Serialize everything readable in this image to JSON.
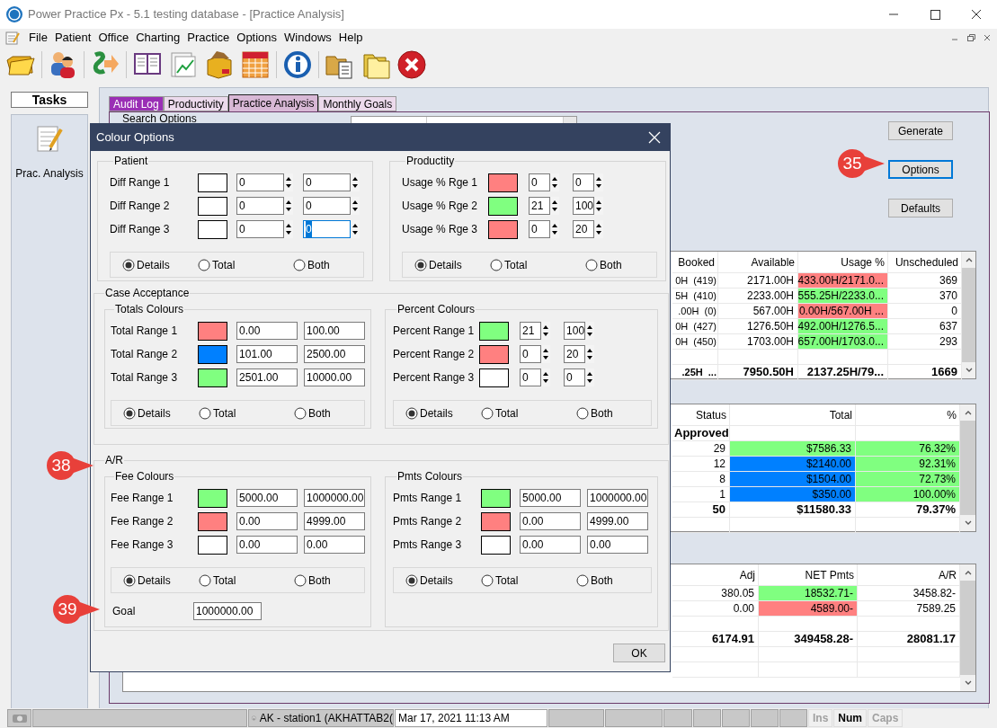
{
  "window": {
    "title": "Power Practice Px - 5.1 testing database - [Practice Analysis]"
  },
  "menu": [
    "File",
    "Patient",
    "Office",
    "Charting",
    "Practice",
    "Options",
    "Windows",
    "Help"
  ],
  "tasks": {
    "title": "Tasks",
    "items": [
      "Prac. Analysis"
    ]
  },
  "tabs": [
    {
      "label": "Audit Log",
      "selected": false,
      "color": "#9a2fb5"
    },
    {
      "label": "Productivity",
      "selected": false,
      "color": "#ecdaec"
    },
    {
      "label": "Practice Analysis",
      "selected": true,
      "color": "#d8b8d6"
    },
    {
      "label": "Monthly Goals",
      "selected": false,
      "color": "#ecdaec"
    }
  ],
  "search_options": {
    "label": "Search Options"
  },
  "buttons": [
    {
      "label": "Generate",
      "focused": false
    },
    {
      "label": "Options",
      "focused": true
    },
    {
      "label": "Defaults",
      "focused": false
    }
  ],
  "tables": [
    {
      "columns": [
        "Booked",
        "Available",
        "Usage %",
        "Unscheduled"
      ],
      "rows": [
        {
          "kind": "data",
          "cells": [
            {
              "text": "0H  (419)"
            },
            {
              "text": "2171.00H"
            },
            {
              "text": "433.00H/2171.0...",
              "color": "#ff8080"
            },
            {
              "text": "369"
            }
          ]
        },
        {
          "kind": "data",
          "cells": [
            {
              "text": "5H  (410)"
            },
            {
              "text": "2233.00H"
            },
            {
              "text": "555.25H/2233.0...",
              "color": "#80ff80"
            },
            {
              "text": "370"
            }
          ]
        },
        {
          "kind": "data",
          "cells": [
            {
              "text": ".00H  (0)"
            },
            {
              "text": "567.00H"
            },
            {
              "text": "0.00H/567.00H ...",
              "color": "#ff8080"
            },
            {
              "text": "0"
            }
          ]
        },
        {
          "kind": "data",
          "cells": [
            {
              "text": "0H  (427)"
            },
            {
              "text": "1276.50H"
            },
            {
              "text": "492.00H/1276.5...",
              "color": "#80ff80"
            },
            {
              "text": "637"
            }
          ]
        },
        {
          "kind": "data",
          "cells": [
            {
              "text": "0H  (450)"
            },
            {
              "text": "1703.00H"
            },
            {
              "text": "657.00H/1703.0...",
              "color": "#80ff80"
            },
            {
              "text": "293"
            }
          ]
        },
        {
          "kind": "blank"
        },
        {
          "kind": "total",
          "cells": [
            {
              "text": ".25H  ..."
            },
            {
              "text": "7950.50H"
            },
            {
              "text": "2137.25H/79..."
            },
            {
              "text": "1669"
            }
          ]
        }
      ]
    },
    {
      "columns": [
        "Status",
        "Total",
        "%"
      ],
      "rows": [
        {
          "kind": "group",
          "cells": [
            {
              "text": "Approved"
            }
          ]
        },
        {
          "kind": "data",
          "cells": [
            {
              "text": "29"
            },
            {
              "text": "$7586.33",
              "color": "#80ff80"
            },
            {
              "text": "76.32%",
              "color": "#80ff80"
            }
          ]
        },
        {
          "kind": "data",
          "cells": [
            {
              "text": "12"
            },
            {
              "text": "$2140.00",
              "color": "#0080ff"
            },
            {
              "text": "92.31%",
              "color": "#80ff80"
            }
          ]
        },
        {
          "kind": "data",
          "cells": [
            {
              "text": "8"
            },
            {
              "text": "$1504.00",
              "color": "#0080ff"
            },
            {
              "text": "72.73%",
              "color": "#80ff80"
            }
          ]
        },
        {
          "kind": "data",
          "cells": [
            {
              "text": "1"
            },
            {
              "text": "$350.00",
              "color": "#0080ff"
            },
            {
              "text": "100.00%",
              "color": "#80ff80"
            }
          ]
        },
        {
          "kind": "total",
          "cells": [
            {
              "text": "50"
            },
            {
              "text": "$11580.33"
            },
            {
              "text": "79.37%"
            }
          ]
        },
        {
          "kind": "blank"
        }
      ]
    },
    {
      "columns": [
        "Adj",
        "NET Pmts",
        "A/R"
      ],
      "rows": [
        {
          "kind": "data",
          "cells": [
            {
              "text": "380.05"
            },
            {
              "text": "18532.71-",
              "color": "#80ff80"
            },
            {
              "text": "3458.82-"
            }
          ]
        },
        {
          "kind": "data",
          "cells": [
            {
              "text": "0.00"
            },
            {
              "text": "4589.00-",
              "color": "#ff8080"
            },
            {
              "text": "7589.25"
            }
          ]
        },
        {
          "kind": "blank"
        },
        {
          "kind": "total",
          "cells": [
            {
              "text": "6174.91"
            },
            {
              "text": "349458.28-"
            },
            {
              "text": "28081.17"
            }
          ]
        },
        {
          "kind": "blank"
        },
        {
          "kind": "blank"
        }
      ]
    }
  ],
  "dialog": {
    "title": "Colour Options",
    "top": [
      {
        "title": "Patient",
        "kind": "wide_spin",
        "ranges": [
          {
            "label": "Diff Range 1",
            "color": "#ffffff",
            "from": "0",
            "to": "0",
            "to_focused": false
          },
          {
            "label": "Diff Range 2",
            "color": "#ffffff",
            "from": "0",
            "to": "0",
            "to_focused": false
          },
          {
            "label": "Diff Range 3",
            "color": "#ffffff",
            "from": "0",
            "to": "0",
            "to_focused": true
          }
        ],
        "radios": [
          {
            "label": "Details",
            "selected": true
          },
          {
            "label": "Total",
            "selected": false
          },
          {
            "label": "Both",
            "selected": false
          }
        ]
      },
      {
        "title": "Productity",
        "kind": "narrow_spin",
        "ranges": [
          {
            "label": "Usage % Rge 1",
            "color": "#ff8080",
            "from": "0",
            "to": "0"
          },
          {
            "label": "Usage % Rge 2",
            "color": "#80ff80",
            "from": "21",
            "to": "100"
          },
          {
            "label": "Usage % Rge 3",
            "color": "#ff8080",
            "from": "0",
            "to": "20"
          }
        ],
        "radios": [
          {
            "label": "Details",
            "selected": true
          },
          {
            "label": "Total",
            "selected": false
          },
          {
            "label": "Both",
            "selected": false
          }
        ]
      }
    ],
    "case_acceptance": {
      "title": "Case Acceptance",
      "groups": [
        {
          "title": "Totals Colours",
          "kind": "text",
          "ranges": [
            {
              "label": "Total Range 1",
              "color": "#ff8080",
              "from": "0.00",
              "to": "100.00"
            },
            {
              "label": "Total Range 2",
              "color": "#0080ff",
              "from": "101.00",
              "to": "2500.00"
            },
            {
              "label": "Total Range 3",
              "color": "#80ff80",
              "from": "2501.00",
              "to": "10000.00"
            }
          ],
          "radios": [
            {
              "label": "Details",
              "selected": true
            },
            {
              "label": "Total",
              "selected": false
            },
            {
              "label": "Both",
              "selected": false
            }
          ]
        },
        {
          "title": "Percent Colours",
          "kind": "narrow_spin",
          "ranges": [
            {
              "label": "Percent Range 1",
              "color": "#80ff80",
              "from": "21",
              "to": "100"
            },
            {
              "label": "Percent Range 2",
              "color": "#ff8080",
              "from": "0",
              "to": "20"
            },
            {
              "label": "Percent Range 3",
              "color": "#ffffff",
              "from": "0",
              "to": "0"
            }
          ],
          "radios": [
            {
              "label": "Details",
              "selected": true
            },
            {
              "label": "Total",
              "selected": false
            },
            {
              "label": "Both",
              "selected": false
            }
          ]
        }
      ]
    },
    "ar": {
      "title": "A/R",
      "groups": [
        {
          "title": "Fee Colours",
          "kind": "text",
          "ranges": [
            {
              "label": "Fee Range 1",
              "color": "#80ff80",
              "from": "5000.00",
              "to": "1000000.00"
            },
            {
              "label": "Fee Range 2",
              "color": "#ff8080",
              "from": "0.00",
              "to": "4999.00"
            },
            {
              "label": "Fee Range 3",
              "color": "#ffffff",
              "from": "0.00",
              "to": "0.00"
            }
          ],
          "radios": [
            {
              "label": "Details",
              "selected": true
            },
            {
              "label": "Total",
              "selected": false
            },
            {
              "label": "Both",
              "selected": false
            }
          ],
          "goal": {
            "label": "Goal",
            "value": "1000000.00"
          }
        },
        {
          "title": "Pmts Colours",
          "kind": "text",
          "ranges": [
            {
              "label": "Pmts Range 1",
              "color": "#80ff80",
              "from": "5000.00",
              "to": "1000000.00"
            },
            {
              "label": "Pmts Range 2",
              "color": "#ff8080",
              "from": "0.00",
              "to": "4999.00"
            },
            {
              "label": "Pmts Range 3",
              "color": "#ffffff",
              "from": "0.00",
              "to": "0.00"
            }
          ],
          "radios": [
            {
              "label": "Details",
              "selected": true
            },
            {
              "label": "Total",
              "selected": false
            },
            {
              "label": "Both",
              "selected": false
            }
          ]
        }
      ]
    },
    "ok_button": "OK"
  },
  "callouts": [
    "35",
    "38",
    "39"
  ],
  "status_bar": {
    "user": "AK - station1 (AKHATTAB2(",
    "datetime": "Mar 17, 2021 11:13 AM",
    "keys": [
      {
        "label": "Ins",
        "on": false
      },
      {
        "label": "Num",
        "on": true
      },
      {
        "label": "Caps",
        "on": false
      }
    ]
  }
}
